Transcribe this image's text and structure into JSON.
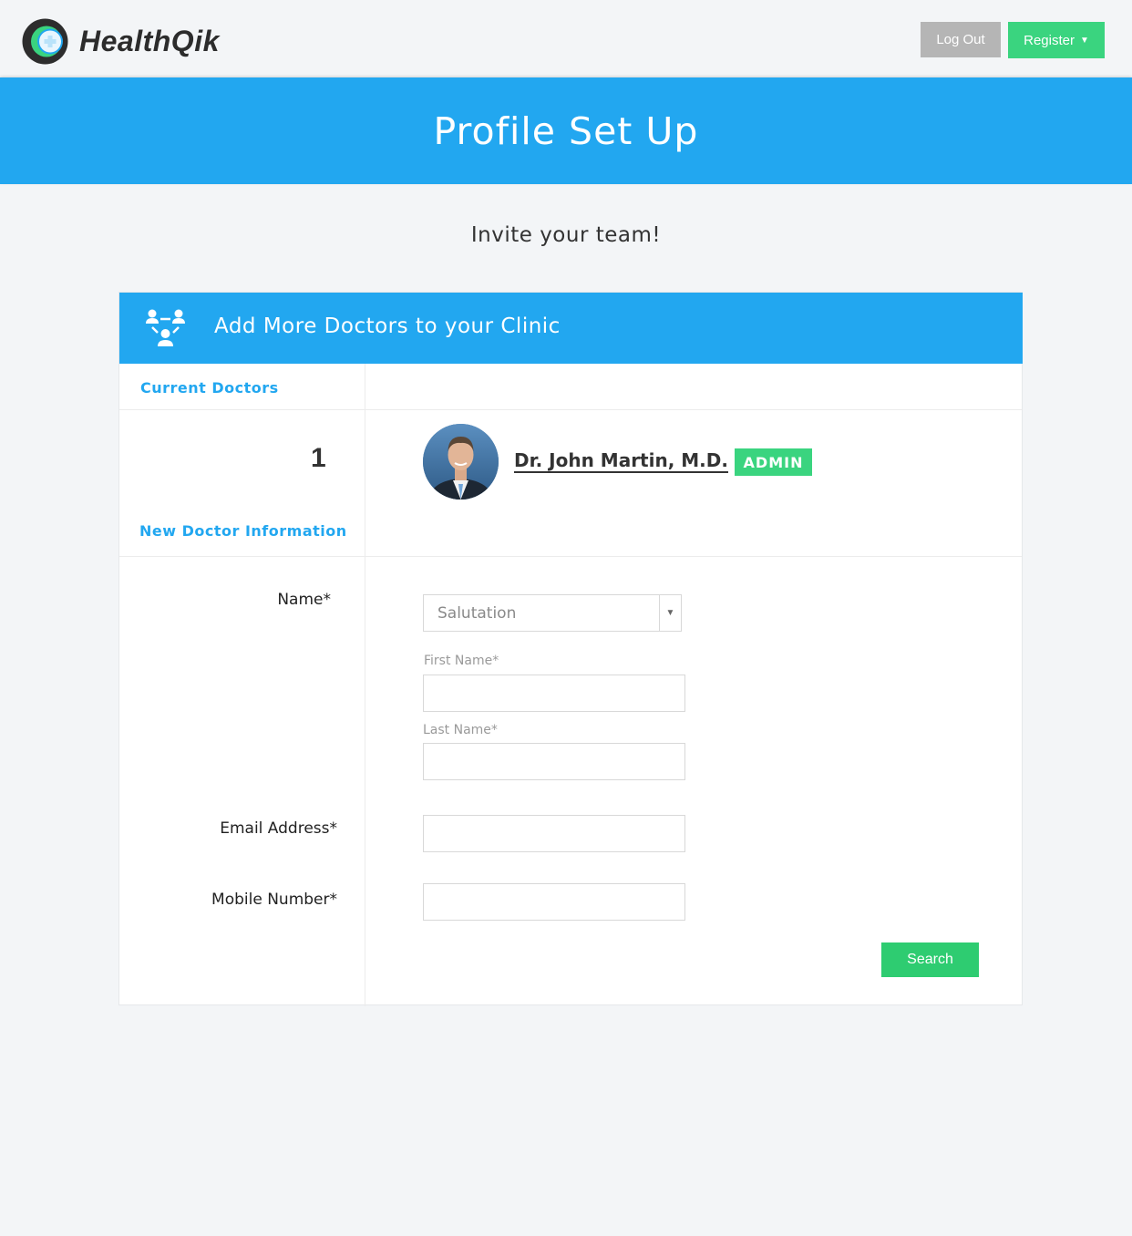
{
  "brand": {
    "name": "HealthQik",
    "colors": {
      "primary_blue": "#22a7f0",
      "accent_green": "#3ad47f",
      "button_gray": "#b5b5b5"
    }
  },
  "header": {
    "logout_label": "Log Out",
    "register_label": "Register"
  },
  "hero": {
    "title": "Profile Set Up"
  },
  "page": {
    "subtitle": "Invite your team!"
  },
  "card": {
    "title": "Add More Doctors to your Clinic",
    "icon": "team-icon",
    "current_doctors_label": "Current Doctors",
    "current_doctors_count": "1",
    "doctors": [
      {
        "name": "Dr. John Martin, M.D.",
        "badge": "ADMIN"
      }
    ],
    "new_doctor_label": "New Doctor Information"
  },
  "form": {
    "name_label": "Name*",
    "salutation_placeholder": "Salutation",
    "first_name_label": "First Name*",
    "first_name_value": "",
    "last_name_label": "Last Name*",
    "last_name_value": "",
    "email_label": "Email Address*",
    "email_value": "",
    "mobile_label": "Mobile Number*",
    "mobile_value": "",
    "submit_label": "Search"
  }
}
